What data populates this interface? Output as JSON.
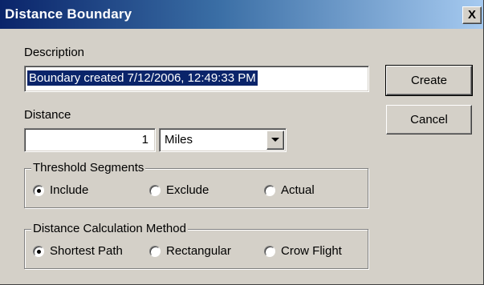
{
  "window": {
    "title": "Distance Boundary",
    "close_label": "X"
  },
  "description": {
    "label": "Description",
    "value": "Boundary created 7/12/2006, 12:49:33 PM"
  },
  "distance": {
    "label": "Distance",
    "value": "1",
    "units_selected": "Miles"
  },
  "buttons": {
    "create": "Create",
    "cancel": "Cancel"
  },
  "threshold_segments": {
    "title": "Threshold Segments",
    "options": [
      {
        "label": "Include",
        "checked": true
      },
      {
        "label": "Exclude",
        "checked": false
      },
      {
        "label": "Actual",
        "checked": false
      }
    ]
  },
  "calc_method": {
    "title": "Distance Calculation Method",
    "options": [
      {
        "label": "Shortest Path",
        "checked": true
      },
      {
        "label": "Rectangular",
        "checked": false
      },
      {
        "label": "Crow Flight",
        "checked": false
      }
    ]
  },
  "colors": {
    "title_start": "#0a246a",
    "title_end": "#a6caf0",
    "face": "#d4d0c8",
    "selection": "#0a246a"
  }
}
